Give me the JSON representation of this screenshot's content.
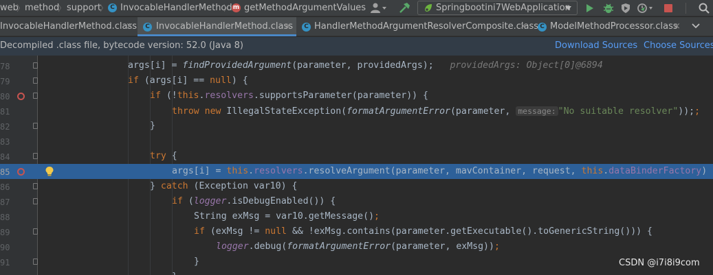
{
  "navbar": {
    "crumbs": [
      "web",
      "method",
      "support",
      "InvocableHandlerMethod",
      "getMethodArgumentValues"
    ],
    "run_config": "Springbootini7WebApplication"
  },
  "tabs": [
    {
      "label": "InvocableHandlerMethod.class",
      "active": false
    },
    {
      "label": "InvocableHandlerMethod.class",
      "active": true
    },
    {
      "label": "HandlerMethodArgumentResolverComposite.class",
      "active": false
    },
    {
      "label": "ModelMethodProcessor.class",
      "active": false
    }
  ],
  "banner": {
    "text": "Decompiled .class file, bytecode version: 52.0 (Java 8)",
    "download_sources": "Download Sources",
    "choose_sources": "Choose Sources..."
  },
  "editor": {
    "lines": [
      {
        "num": "78",
        "code": "args[i] = findProvidedArgument(parameter, providedArgs);",
        "hint": "providedArgs: Object[0]@6894"
      },
      {
        "num": "79",
        "code": "if (args[i] == null) {"
      },
      {
        "num": "80",
        "code": "if (!this.resolvers.supportsParameter(parameter)) {"
      },
      {
        "num": "81",
        "code": "throw new IllegalStateException(formatArgumentError(parameter,",
        "param_hint": "message:",
        "string": "\"No suitable resolver\"",
        "tail": "));"
      },
      {
        "num": "82",
        "code": "}"
      },
      {
        "num": "83",
        "code": ""
      },
      {
        "num": "84",
        "code": "try {"
      },
      {
        "num": "85",
        "code": "args[i] = this.resolvers.resolveArgument(parameter, mavContainer, request, this.dataBinderFactory)"
      },
      {
        "num": "86",
        "code": "} catch (Exception var10) {"
      },
      {
        "num": "87",
        "code": "if (logger.isDebugEnabled()) {"
      },
      {
        "num": "88",
        "code": "String exMsg = var10.getMessage();"
      },
      {
        "num": "89",
        "code": "if (exMsg != null && !exMsg.contains(parameter.getExecutable().toGenericString())) {"
      },
      {
        "num": "90",
        "code": "logger.debug(formatArgumentError(parameter, exMsg));"
      },
      {
        "num": "91",
        "code": "}"
      }
    ],
    "current_line": "85"
  },
  "watermark": "CSDN @i7i8i9com",
  "colors": {
    "keyword": "#cc7832",
    "field": "#9876aa",
    "string": "#6a8759",
    "current_line": "#2d6099",
    "breakpoint": "#c75450"
  }
}
